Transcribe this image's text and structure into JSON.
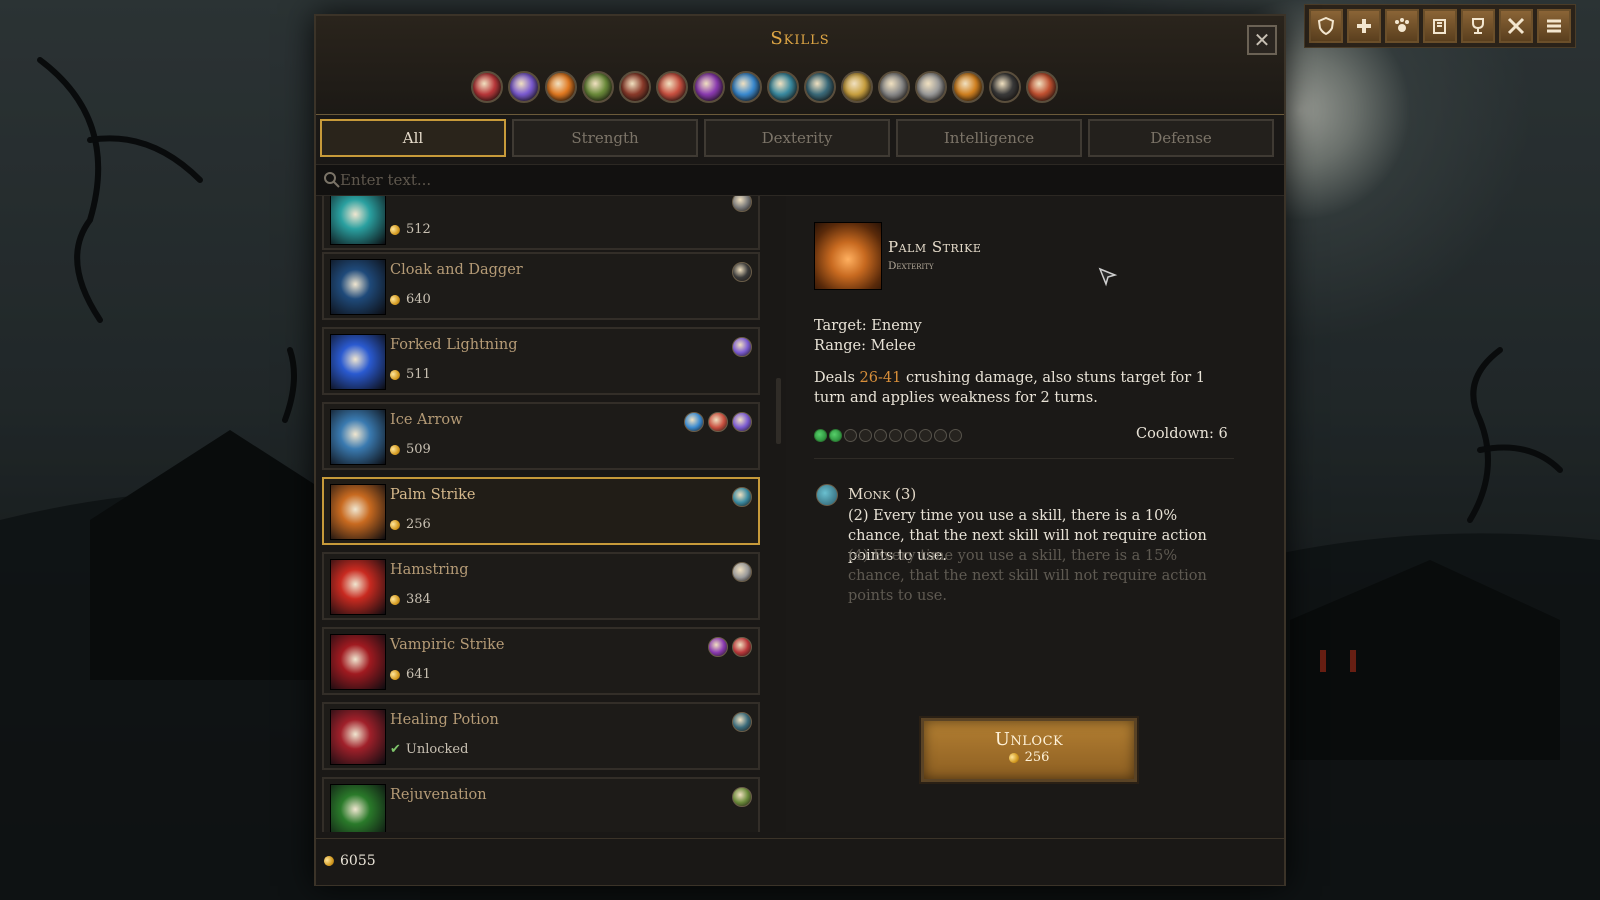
{
  "window": {
    "title": "Skills",
    "close_glyph": "✕"
  },
  "category_icons": [
    {
      "name": "crossed-weapons-icon",
      "color": "#b8373a"
    },
    {
      "name": "magic-orbs-icon",
      "color": "#7a5ad0"
    },
    {
      "name": "fire-icon",
      "color": "#e07820"
    },
    {
      "name": "tree-spirit-icon",
      "color": "#6a8a3a"
    },
    {
      "name": "spellbook-icon",
      "color": "#8a3a2a"
    },
    {
      "name": "target-icon",
      "color": "#c85040"
    },
    {
      "name": "staff-icon",
      "color": "#8a3ab0"
    },
    {
      "name": "crystal-icon",
      "color": "#3a8ad0"
    },
    {
      "name": "fist-icon",
      "color": "#3a8aa0"
    },
    {
      "name": "arrow-icon",
      "color": "#3a6a7a"
    },
    {
      "name": "shield-icon",
      "color": "#c8a040"
    },
    {
      "name": "helmet-icon",
      "color": "#8a8a8a"
    },
    {
      "name": "hammer-icon",
      "color": "#9a9a9a"
    },
    {
      "name": "paw-icon",
      "color": "#d08020"
    },
    {
      "name": "hooded-figure-icon",
      "color": "#3a3a3a"
    },
    {
      "name": "gear-icon",
      "color": "#c05030"
    }
  ],
  "tabs": [
    "All",
    "Strength",
    "Dexterity",
    "Intelligence",
    "Defense"
  ],
  "search": {
    "placeholder": "Enter text..."
  },
  "skills": [
    {
      "name": "",
      "price": "512",
      "thumb": "#2aa0a0",
      "tags": [
        "#7a7a7a"
      ]
    },
    {
      "name": "Cloak and Dagger",
      "price": "640",
      "thumb": "#1f4a7a",
      "tags": [
        "#3a3a3a"
      ]
    },
    {
      "name": "Forked Lightning",
      "price": "511",
      "thumb": "#2a5ad0",
      "tags": [
        "#7a5ad0"
      ]
    },
    {
      "name": "Ice Arrow",
      "price": "509",
      "thumb": "#3a7ab0",
      "tags": [
        "#3a8ad0",
        "#c85040",
        "#7a5ad0"
      ]
    },
    {
      "name": "Palm Strike",
      "price": "256",
      "thumb": "#c86a20",
      "tags": [
        "#3a8aa0"
      ]
    },
    {
      "name": "Hamstring",
      "price": "384",
      "thumb": "#c82a20",
      "tags": [
        "#9a9a9a"
      ]
    },
    {
      "name": "Vampiric Strike",
      "price": "641",
      "thumb": "#a01a20",
      "tags": [
        "#8a3ab0",
        "#b8373a"
      ]
    },
    {
      "name": "Healing Potion",
      "price": "Unlocked",
      "thumb": "#a0202a",
      "tags": [
        "#3a6a7a"
      ]
    },
    {
      "name": "Rejuvenation",
      "price": "",
      "thumb": "#2a7a2a",
      "tags": [
        "#6a8a3a"
      ]
    }
  ],
  "detail": {
    "name": "Palm Strike",
    "category": "Dexterity",
    "target": "Target: Enemy",
    "range": "Range: Melee",
    "desc_pre": "Deals ",
    "desc_dmg": "26-41",
    "desc_post": " crushing damage, also stuns target for 1 turn and applies weakness for 2 turns.",
    "ap_filled": 2,
    "ap_total": 10,
    "cooldown": "Cooldown: 6",
    "set_title": "Monk (3)",
    "set_bonus_active": "(2) Every time you use a skill, there is a 10% chance, that the next skill will not require action points to use.",
    "set_bonus_inactive": "(4) Every time you use a skill, there is a 15% chance, that the next skill will not require action points to use.",
    "unlock_label": "Unlock",
    "unlock_price": "256"
  },
  "footer": {
    "gold": "6055"
  },
  "toolbar": [
    "shield-icon",
    "plus-icon",
    "pawprint-icon",
    "journal-icon",
    "trophy-icon",
    "crossed-swords-icon",
    "menu-icon"
  ]
}
